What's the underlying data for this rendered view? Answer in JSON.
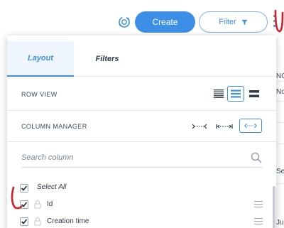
{
  "toolbar": {
    "sync_icon": "sync-icon",
    "create_label": "Create",
    "filter_label": "Filter",
    "filter_icon": "funnel-icon",
    "more_icon": "kebab-icon"
  },
  "background_table": {
    "right_edge_fragments": [
      "NC",
      "No",
      "Se",
      "Ju"
    ]
  },
  "panel": {
    "tabs": [
      {
        "label": "Layout",
        "active": true
      },
      {
        "label": "Filters",
        "active": false
      }
    ],
    "row_view": {
      "label": "ROW VIEW",
      "options": [
        {
          "icon": "row-view-compact-icon",
          "selected": false
        },
        {
          "icon": "row-view-standard-icon",
          "selected": true
        },
        {
          "icon": "row-view-comfortable-icon",
          "selected": false
        }
      ]
    },
    "column_manager": {
      "label": "COLUMN MANAGER",
      "options": [
        {
          "icon": "collapse-columns-icon",
          "selected": false
        },
        {
          "icon": "fit-columns-icon",
          "selected": false
        },
        {
          "icon": "expand-columns-icon",
          "selected": true
        }
      ]
    },
    "search": {
      "placeholder": "Search column",
      "value": ""
    },
    "columns": {
      "select_all_label": "Select All",
      "items": [
        {
          "label": "Id",
          "checked": true,
          "locked": true
        },
        {
          "label": "Creation time",
          "checked": true,
          "locked": true
        }
      ]
    }
  },
  "colors": {
    "accent": "#3d8ee6",
    "annotation": "#d0202a"
  }
}
